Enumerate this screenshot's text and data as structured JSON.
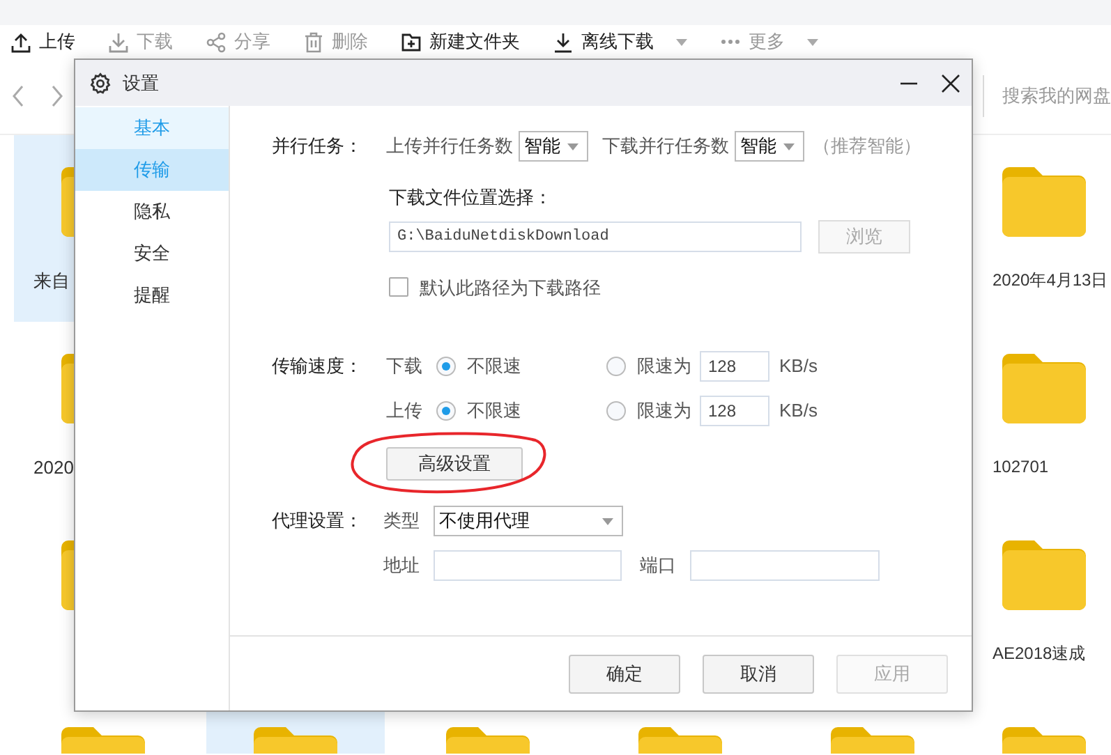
{
  "toolbar": [
    {
      "label": "上传",
      "disabled": false,
      "dropdown": false
    },
    {
      "label": "下载",
      "disabled": true,
      "dropdown": false
    },
    {
      "label": "分享",
      "disabled": true,
      "dropdown": false
    },
    {
      "label": "删除",
      "disabled": true,
      "dropdown": false
    },
    {
      "label": "新建文件夹",
      "disabled": false,
      "dropdown": false
    },
    {
      "label": "离线下载",
      "disabled": false,
      "dropdown": true
    },
    {
      "label": "更多",
      "disabled": true,
      "dropdown": true
    }
  ],
  "search": {
    "placeholder": "搜索我的网盘"
  },
  "files": {
    "rows": [
      {
        "left": {
          "label": "来自",
          "selected": true
        },
        "right": {
          "label": "2020年4月13日",
          "selected": false
        }
      },
      {
        "left": {
          "label": "2020",
          "selected": false
        },
        "right": {
          "label": "102701",
          "selected": false
        }
      },
      {
        "left": {
          "selected": false
        },
        "right": {
          "label": "AE2018速成",
          "selected": false
        }
      }
    ],
    "bottom_row": [
      {
        "selected": false
      },
      {
        "selected": true
      },
      {
        "selected": false
      },
      {
        "selected": false
      },
      {
        "selected": false
      },
      {
        "selected": false
      }
    ]
  },
  "dialog": {
    "title": "设置",
    "sidebar": [
      {
        "label": "基本",
        "selected": false,
        "hovered": true
      },
      {
        "label": "传输",
        "selected": true,
        "hovered": false
      },
      {
        "label": "隐私",
        "selected": false,
        "hovered": false
      },
      {
        "label": "安全",
        "selected": false,
        "hovered": false
      },
      {
        "label": "提醒",
        "selected": false,
        "hovered": false
      }
    ],
    "parallel": {
      "label": "并行任务：",
      "upload_label": "上传并行任务数",
      "upload_value": "智能",
      "download_label": "下载并行任务数",
      "download_value": "智能",
      "hint": "（推荐智能）"
    },
    "location": {
      "label": "下载文件位置选择：",
      "path": "G:\\BaiduNetdiskDownload",
      "browse": "浏览",
      "browse_disabled": true,
      "default_label": "默认此路径为下载路径",
      "default_checked": false
    },
    "speed": {
      "label": "传输速度：",
      "rows": [
        {
          "label": "下载",
          "options": [
            {
              "label": "不限速",
              "selected": true
            },
            {
              "label": "限速为",
              "selected": false
            }
          ],
          "limit": "128",
          "unit": "KB/s"
        },
        {
          "label": "上传",
          "options": [
            {
              "label": "不限速",
              "selected": true
            },
            {
              "label": "限速为",
              "selected": false
            }
          ],
          "limit": "128",
          "unit": "KB/s"
        }
      ]
    },
    "advanced_button": "高级设置",
    "proxy": {
      "label": "代理设置：",
      "type_label": "类型",
      "type_value": "不使用代理",
      "address_label": "地址",
      "port_label": "端口"
    },
    "buttons": [
      {
        "label": "确定",
        "disabled": false
      },
      {
        "label": "取消",
        "disabled": false
      },
      {
        "label": "应用",
        "disabled": true
      }
    ]
  }
}
